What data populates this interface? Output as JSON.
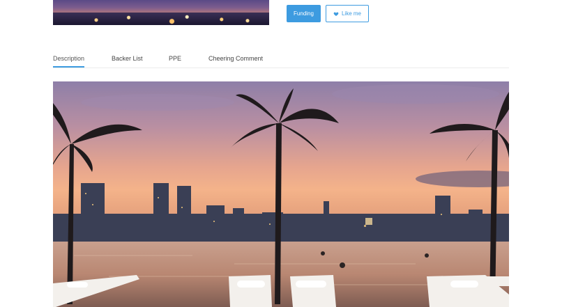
{
  "actions": {
    "funding_label": "Funding",
    "like_label": "Like me"
  },
  "tabs": [
    {
      "label": "Description",
      "active": true
    },
    {
      "label": "Backer List",
      "active": false
    },
    {
      "label": "PPE",
      "active": false
    },
    {
      "label": "Cheering Comment",
      "active": false
    }
  ],
  "colors": {
    "accent": "#3d9be0"
  },
  "icons": {
    "like": "heart-icon"
  }
}
